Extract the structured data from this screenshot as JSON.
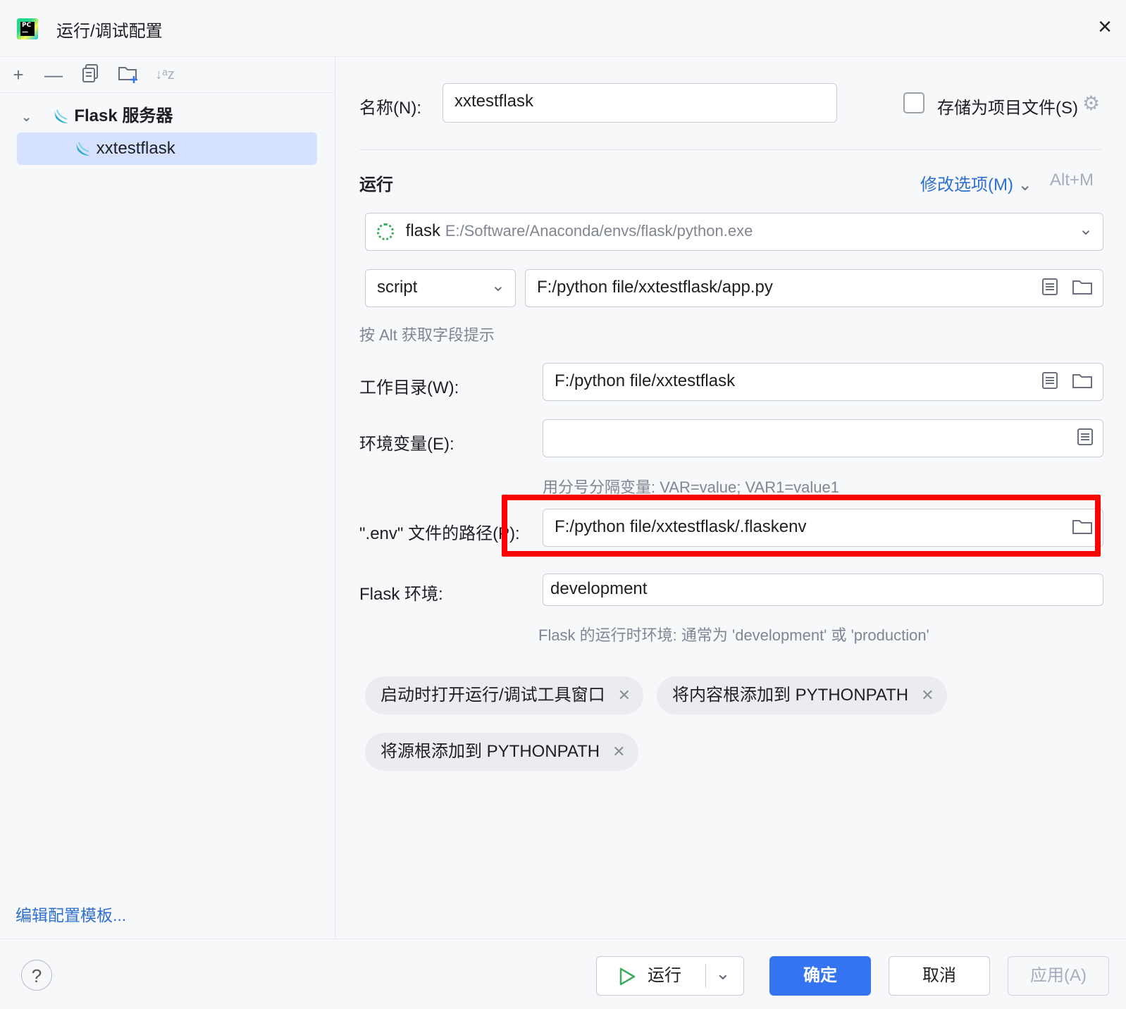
{
  "window": {
    "title": "运行/调试配置",
    "close_icon": "×"
  },
  "toolbar": {
    "add": "+",
    "remove": "—",
    "copy": "⧉",
    "new_folder": "🗀",
    "sort": "↓ᵃz"
  },
  "tree": {
    "group_label": "Flask 服务器",
    "item_label": "xxtestflask"
  },
  "left_footer": {
    "edit_templates": "编辑配置模板..."
  },
  "form": {
    "name_label": "名称(N):",
    "name_value": "xxtestflask",
    "store_label": "存储为项目文件(S)",
    "run_section": "运行",
    "modify_options": "修改选项(M)",
    "modify_shortcut": "Alt+M",
    "interpreter_name": "flask",
    "interpreter_path": "E:/Software/Anaconda/envs/flask/python.exe",
    "script_type": "script",
    "script_path": "F:/python file/xxtestflask/app.py",
    "alt_hint": "按 Alt 获取字段提示",
    "workdir_label": "工作目录(W):",
    "workdir_value": "F:/python file/xxtestflask",
    "env_label": "环境变量(E):",
    "env_value": "",
    "env_hint": "用分号分隔变量: VAR=value; VAR1=value1",
    "dotenv_label": "\".env\" 文件的路径(P):",
    "dotenv_value": "F:/python file/xxtestflask/.flaskenv",
    "flask_env_label": "Flask 环境:",
    "flask_env_value": "development",
    "flask_env_hint": "Flask 的运行时环境: 通常为 'development' 或 'production'"
  },
  "chips": [
    {
      "label": "启动时打开运行/调试工具窗口"
    },
    {
      "label": "将内容根添加到 PYTHONPATH"
    },
    {
      "label": "将源根添加到 PYTHONPATH"
    }
  ],
  "footer": {
    "help": "?",
    "run": "运行",
    "ok": "确定",
    "cancel": "取消",
    "apply": "应用(A)"
  },
  "colors": {
    "accent": "#3574f0",
    "highlight": "#ff0000",
    "selection": "#d5e1ff"
  }
}
